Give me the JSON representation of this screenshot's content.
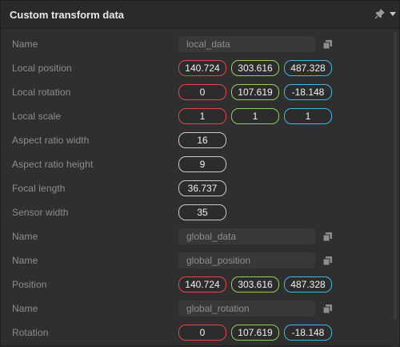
{
  "panel": {
    "title": "Custom transform data",
    "icons": {
      "pin": "pin-icon",
      "menu": "dropdown-arrow-icon",
      "copy": "copy-icon"
    }
  },
  "rows": {
    "name1": {
      "label": "Name",
      "value": "local_data"
    },
    "local_position": {
      "label": "Local  position",
      "x": "140.724",
      "y": "303.616",
      "z": "487.328"
    },
    "local_rotation": {
      "label": "Local  rotation",
      "x": "0",
      "y": "107.619",
      "z": "-18.148"
    },
    "local_scale": {
      "label": "Local  scale",
      "x": "1",
      "y": "1",
      "z": "1"
    },
    "aspect_width": {
      "label": "Aspect ratio width",
      "value": "16"
    },
    "aspect_height": {
      "label": "Aspect ratio height",
      "value": "9"
    },
    "focal_length": {
      "label": "Focal length",
      "value": "36.737"
    },
    "sensor_width": {
      "label": "Sensor width",
      "value": "35"
    },
    "name2": {
      "label": "Name",
      "value": "global_data"
    },
    "name3": {
      "label": "Name",
      "value": "global_position"
    },
    "position": {
      "label": "Position",
      "x": "140.724",
      "y": "303.616",
      "z": "487.328"
    },
    "name4": {
      "label": "Name",
      "value": "global_rotation"
    },
    "rotation": {
      "label": "Rotation",
      "x": "0",
      "y": "107.619",
      "z": "-18.148"
    }
  },
  "colors": {
    "axis_x": "#e0474c",
    "axis_y": "#8fd15a",
    "axis_z": "#3db9e6",
    "background": "#2f2f2f",
    "label": "#8e8e8e"
  }
}
